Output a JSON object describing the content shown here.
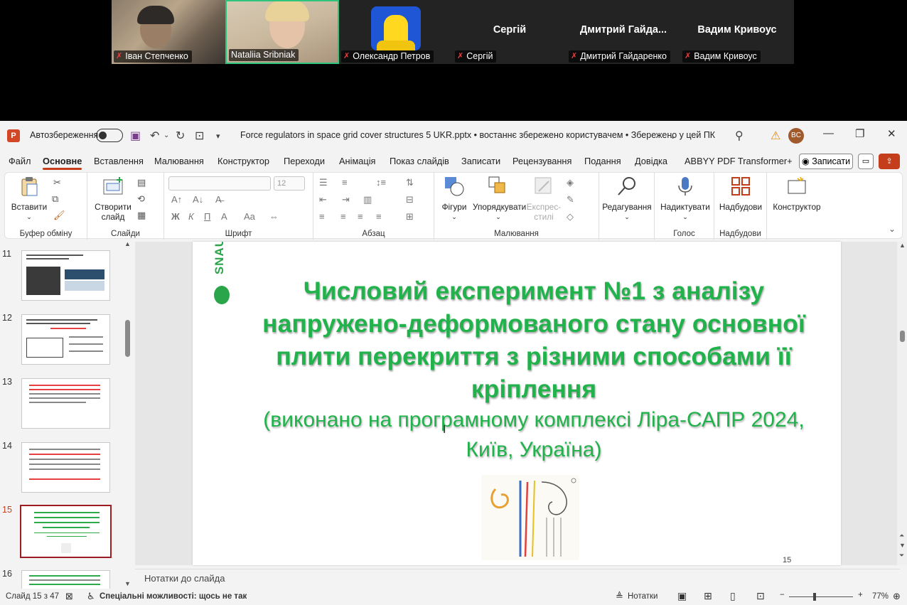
{
  "meeting": {
    "participants": [
      {
        "label": "Іван Степченко",
        "muted": true,
        "type": "video"
      },
      {
        "label": "Nataliia Sribniak",
        "muted": false,
        "type": "video"
      },
      {
        "label": "Олександр Петров",
        "muted": true,
        "type": "avatar"
      },
      {
        "label": "Сергій",
        "center_name": "Сергій",
        "muted": true,
        "type": "name"
      },
      {
        "label": "Дмитрий Гайдаренко",
        "center_name": "Дмитрий  Гайда...",
        "muted": true,
        "type": "name"
      },
      {
        "label": "Вадим Кривоус",
        "center_name": "Вадим Кривоус",
        "muted": true,
        "type": "name"
      }
    ]
  },
  "titlebar": {
    "app_letter": "P",
    "autosave_label": "Автозбереження",
    "document_title": "Force regulators in space grid cover structures 5 UKR.pptx  •  востаннє збережено користувачем  •  Збережено у цей ПК",
    "user_initials": "BC"
  },
  "tabs": [
    {
      "label": "Файл",
      "active": false
    },
    {
      "label": "Основне",
      "active": true
    },
    {
      "label": "Вставлення",
      "active": false
    },
    {
      "label": "Малювання",
      "active": false
    },
    {
      "label": "Конструктор",
      "active": false
    },
    {
      "label": "Переходи",
      "active": false
    },
    {
      "label": "Анімація",
      "active": false
    },
    {
      "label": "Показ слайдів",
      "active": false
    },
    {
      "label": "Записати",
      "active": false
    },
    {
      "label": "Рецензування",
      "active": false
    },
    {
      "label": "Подання",
      "active": false
    },
    {
      "label": "Довідка",
      "active": false
    },
    {
      "label": "ABBYY PDF Transformer+",
      "active": false
    }
  ],
  "record_button": "Записати",
  "ribbon": {
    "paste": "Вставити",
    "new_slide": "Створити слайд",
    "font_size": "12",
    "shapes": "Фігури",
    "arrange": "Упорядкувати",
    "quick_styles": "Експрес-стилі",
    "editing": "Редагування",
    "dictate": "Надиктувати",
    "addins": "Надбудови",
    "designer": "Конструктор",
    "groups": {
      "clipboard": "Буфер обміну",
      "slides": "Слайди",
      "font": "Шрифт",
      "paragraph": "Абзац",
      "drawing": "Малювання",
      "voice": "Голос",
      "addins": "Надбудови"
    }
  },
  "thumbnails": [
    {
      "number": "11",
      "active": false
    },
    {
      "number": "12",
      "active": false
    },
    {
      "number": "13",
      "active": false
    },
    {
      "number": "14",
      "active": false
    },
    {
      "number": "15",
      "active": true
    },
    {
      "number": "16",
      "active": false
    }
  ],
  "slide": {
    "logo_text": "SNAU",
    "title": "Числовий експеримент №1 з аналізу напружено-деформованого стану основної плити перекриття з різними способами її кріплення",
    "subtitle": "(виконано на програмному комплексі Ліра-САПР 2024, Київ, Україна)",
    "page_number": "15"
  },
  "notes_placeholder": "Нотатки до слайда",
  "status": {
    "slide_counter": "Слайд 15 з 47",
    "accessibility": "Спеціальні можливості: щось не так",
    "notes": "Нотатки",
    "zoom": "77%"
  },
  "colors": {
    "accent": "#c43e1c",
    "slide_green": "#22b24c",
    "active_thumb_border": "#9e1c24"
  }
}
